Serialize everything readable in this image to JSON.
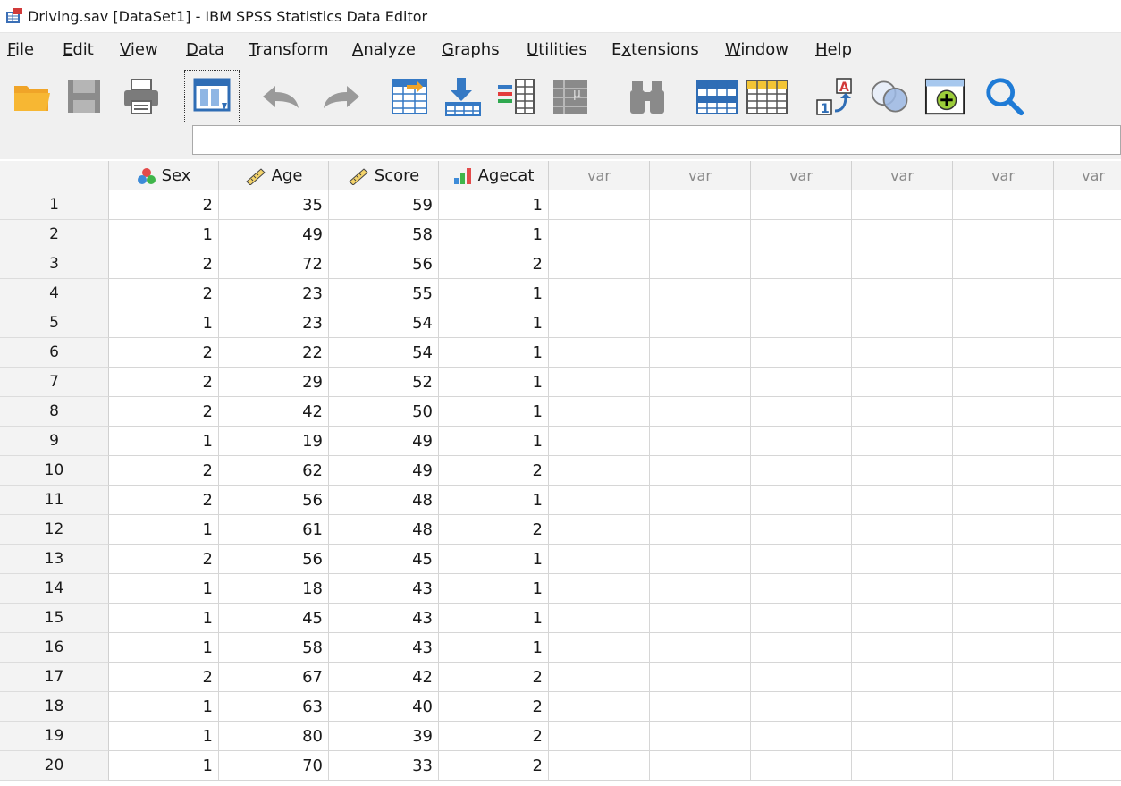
{
  "window": {
    "title": "Driving.sav [DataSet1] - IBM SPSS Statistics Data Editor"
  },
  "menu": [
    {
      "key": "F",
      "rest": "ile"
    },
    {
      "key": "E",
      "rest": "dit"
    },
    {
      "key": "V",
      "rest": "iew"
    },
    {
      "key": "D",
      "rest": "ata"
    },
    {
      "key": "T",
      "rest": "ransform"
    },
    {
      "key": "A",
      "rest": "nalyze"
    },
    {
      "key": "G",
      "rest": "raphs"
    },
    {
      "key": "U",
      "rest": "tilities"
    },
    {
      "pre": "E",
      "key": "x",
      "rest": "tensions"
    },
    {
      "key": "W",
      "rest": "indow"
    },
    {
      "key": "H",
      "rest": "elp"
    }
  ],
  "toolbar": {
    "icons": [
      "open-folder-icon",
      "save-icon",
      "print-icon",
      "recall-dialog-icon",
      "undo-icon",
      "redo-icon",
      "go-to-case-icon",
      "go-to-variable-icon",
      "variables-icon",
      "run-descriptives-icon",
      "find-icon",
      "insert-cases-icon",
      "insert-variable-icon",
      "value-labels-icon",
      "use-variable-sets-icon",
      "show-all-variables-icon",
      "spelling-icon"
    ],
    "cell_editor_value": ""
  },
  "grid": {
    "columns": [
      {
        "name": "Sex",
        "icon": "nominal-icon"
      },
      {
        "name": "Age",
        "icon": "scale-icon"
      },
      {
        "name": "Score",
        "icon": "scale-icon"
      },
      {
        "name": "Agecat",
        "icon": "ordinal-icon"
      },
      {
        "name": "var"
      },
      {
        "name": "var"
      },
      {
        "name": "var"
      },
      {
        "name": "var"
      },
      {
        "name": "var"
      },
      {
        "name": "var"
      }
    ],
    "rows": [
      {
        "n": "1",
        "v": [
          "2",
          "35",
          "59",
          "1"
        ]
      },
      {
        "n": "2",
        "v": [
          "1",
          "49",
          "58",
          "1"
        ]
      },
      {
        "n": "3",
        "v": [
          "2",
          "72",
          "56",
          "2"
        ]
      },
      {
        "n": "4",
        "v": [
          "2",
          "23",
          "55",
          "1"
        ]
      },
      {
        "n": "5",
        "v": [
          "1",
          "23",
          "54",
          "1"
        ]
      },
      {
        "n": "6",
        "v": [
          "2",
          "22",
          "54",
          "1"
        ]
      },
      {
        "n": "7",
        "v": [
          "2",
          "29",
          "52",
          "1"
        ]
      },
      {
        "n": "8",
        "v": [
          "2",
          "42",
          "50",
          "1"
        ]
      },
      {
        "n": "9",
        "v": [
          "1",
          "19",
          "49",
          "1"
        ]
      },
      {
        "n": "10",
        "v": [
          "2",
          "62",
          "49",
          "2"
        ]
      },
      {
        "n": "11",
        "v": [
          "2",
          "56",
          "48",
          "1"
        ]
      },
      {
        "n": "12",
        "v": [
          "1",
          "61",
          "48",
          "2"
        ]
      },
      {
        "n": "13",
        "v": [
          "2",
          "56",
          "45",
          "1"
        ]
      },
      {
        "n": "14",
        "v": [
          "1",
          "18",
          "43",
          "1"
        ]
      },
      {
        "n": "15",
        "v": [
          "1",
          "45",
          "43",
          "1"
        ]
      },
      {
        "n": "16",
        "v": [
          "1",
          "58",
          "43",
          "1"
        ]
      },
      {
        "n": "17",
        "v": [
          "2",
          "67",
          "42",
          "2"
        ]
      },
      {
        "n": "18",
        "v": [
          "1",
          "63",
          "40",
          "2"
        ]
      },
      {
        "n": "19",
        "v": [
          "1",
          "80",
          "39",
          "2"
        ]
      },
      {
        "n": "20",
        "v": [
          "1",
          "70",
          "33",
          "2"
        ]
      }
    ]
  }
}
